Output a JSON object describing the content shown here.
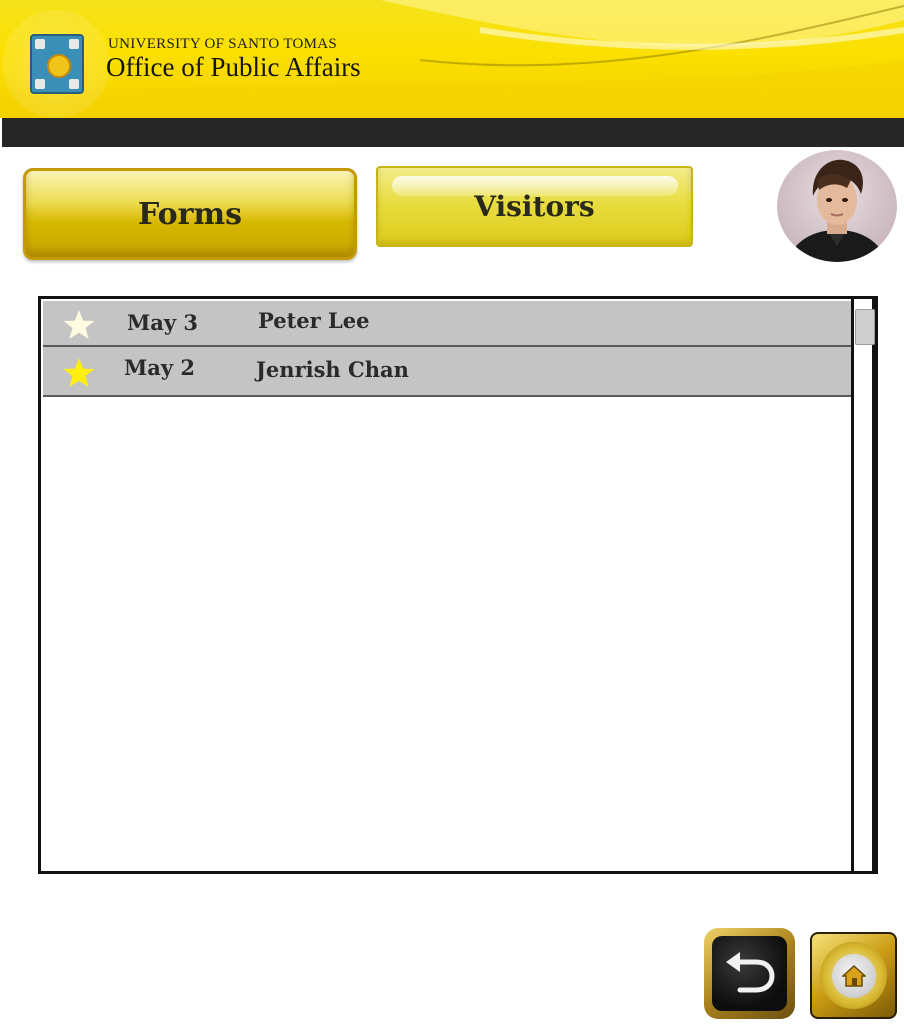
{
  "header": {
    "university": "UNIVERSITY OF SANTO TOMAS",
    "office": "Office of Public Affairs",
    "logo_icon": "ust-seal-icon"
  },
  "tabs": {
    "forms_label": "Forms",
    "visitors_label": "Visitors"
  },
  "profile": {
    "avatar_icon": "user-avatar-photo"
  },
  "visitors_list": {
    "rows": [
      {
        "star_icon": "star-icon",
        "star_color": "#fffbe0",
        "date": "May 3",
        "name": "Peter Lee"
      },
      {
        "star_icon": "star-icon",
        "star_color": "#ffee10",
        "date": "May 2",
        "name": "Jenrish Chan"
      }
    ]
  },
  "footer": {
    "back_icon": "back-arrow-icon",
    "home_icon": "home-icon"
  },
  "colors": {
    "header_yellow": "#fbe000",
    "dark_bar": "#262626",
    "row_gray": "#c4c4c4",
    "gold": "#c99a10"
  }
}
